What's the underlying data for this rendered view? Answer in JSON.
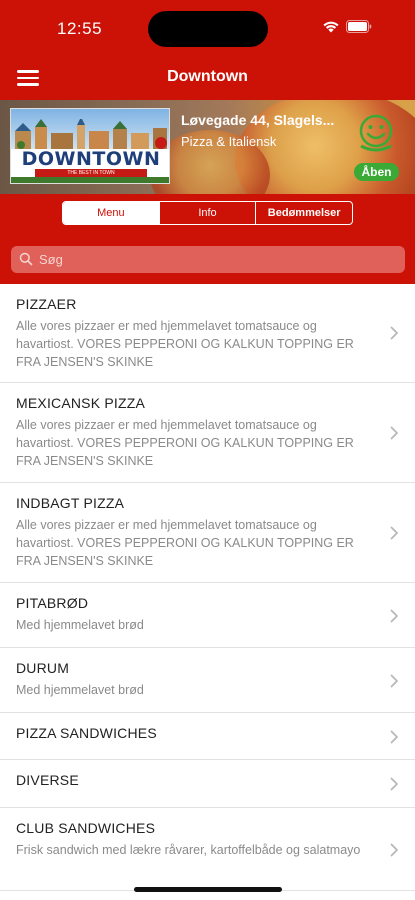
{
  "status": {
    "time": "12:55"
  },
  "nav": {
    "title": "Downtown"
  },
  "restaurant": {
    "address": "Løvegade 44, Slagels...",
    "category": "Pizza & Italiensk",
    "open_label": "Åben",
    "logo_text": "DOWNTOWN",
    "logo_tagline": "THE BEST IN TOWN"
  },
  "tabs": [
    "Menu",
    "Info",
    "Bedømmelser"
  ],
  "search": {
    "placeholder": "Søg"
  },
  "menu_items": [
    {
      "title": "PIZZAER",
      "description": "Alle vores pizzaer er med hjemmelavet tomatsauce og havartiost. VORES PEPPERONI OG KALKUN TOPPING ER FRA JENSEN'S SKINKE"
    },
    {
      "title": "MEXICANSK PIZZA",
      "description": "Alle vores pizzaer er med hjemmelavet tomatsauce og havartiost. VORES PEPPERONI OG KALKUN TOPPING ER FRA JENSEN'S SKINKE"
    },
    {
      "title": "INDBAGT PIZZA",
      "description": "Alle vores pizzaer er med hjemmelavet tomatsauce og havartiost. VORES PEPPERONI OG KALKUN TOPPING ER FRA JENSEN'S SKINKE"
    },
    {
      "title": "PITABRØD",
      "description": "Med hjemmelavet brød"
    },
    {
      "title": "DURUM",
      "description": "Med hjemmelavet brød"
    },
    {
      "title": "PIZZA SANDWICHES",
      "description": ""
    },
    {
      "title": "DIVERSE",
      "description": ""
    },
    {
      "title": "CLUB SANDWICHES",
      "description": "Frisk sandwich med lækre råvarer, kartoffelbåde og salatmayo"
    }
  ],
  "colors": {
    "brand_red": "#cc1106",
    "open_green": "#3aa935"
  }
}
